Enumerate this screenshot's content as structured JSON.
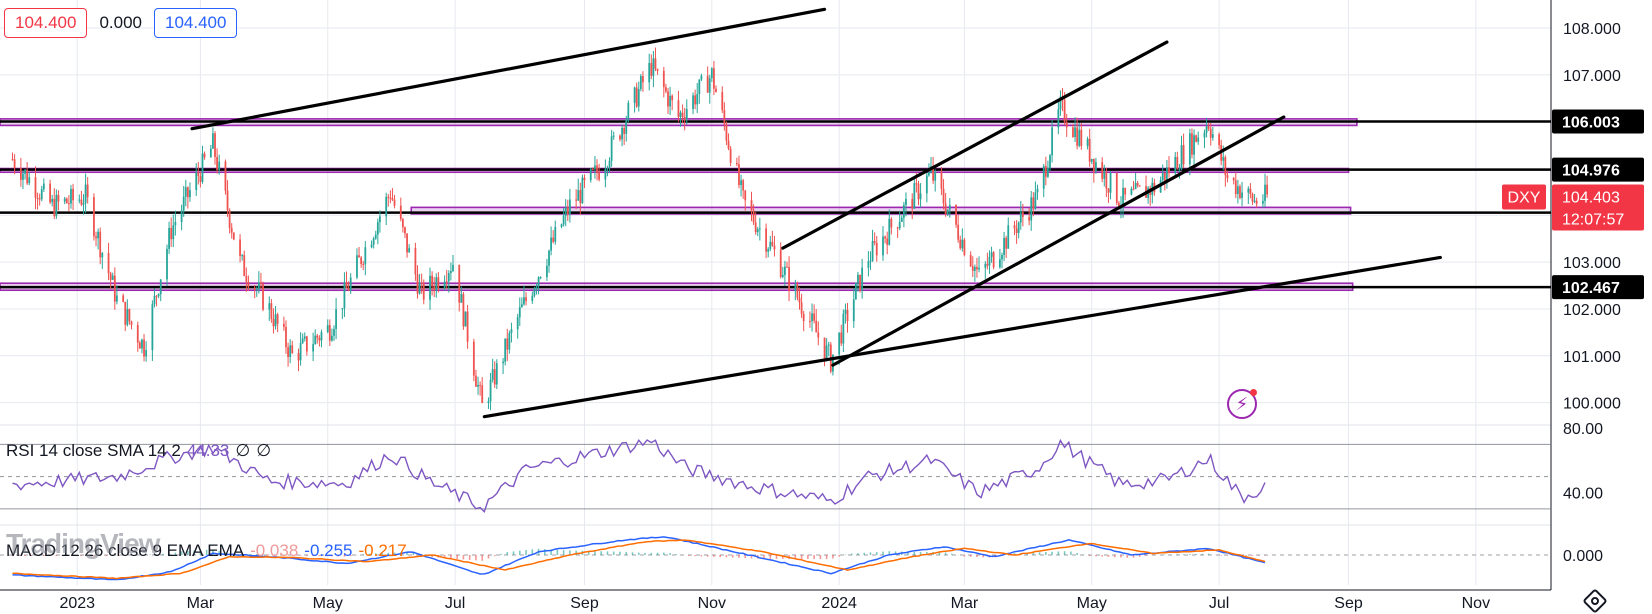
{
  "header": {
    "open_value": "104.400",
    "change_value": "0.000",
    "close_value": "104.400"
  },
  "symbol": {
    "ticker": "DXY",
    "price": "104.403",
    "countdown": "12:07:57"
  },
  "watermark": "TradingView",
  "colors": {
    "up": "#26a69a",
    "down": "#ef5350",
    "zone": "#9c27b0",
    "zone_fill": "rgba(156,39,176,0.22)",
    "trendline": "#000000",
    "rsi": "#7e57c2",
    "macd": "#2962ff",
    "signal": "#ff6d00",
    "price_tag": "#f23645"
  },
  "rsi": {
    "label": "RSI 14 close SMA 14 2",
    "value": "44.33",
    "v2": "∅",
    "v3": "∅"
  },
  "macd": {
    "label": "MACD 12 26 close 9 EMA EMA",
    "histogram": "-0.038",
    "macd": "-0.255",
    "signal": "-0.217"
  },
  "icons": {
    "alert": "lightning-bolt-icon",
    "settings": "settings-icon"
  },
  "chart_data": {
    "type": "candlestick",
    "symbol": "DXY",
    "x_tick_labels": [
      "2023",
      "Mar",
      "May",
      "Jul",
      "Sep",
      "Nov",
      "2024",
      "Mar",
      "May",
      "Jul",
      "Sep",
      "Nov"
    ],
    "x_tick_dates": [
      "2023-01-01",
      "2023-03-01",
      "2023-05-01",
      "2023-07-01",
      "2023-09-01",
      "2023-11-01",
      "2024-01-01",
      "2024-03-01",
      "2024-05-01",
      "2024-07-01",
      "2024-09-01",
      "2024-11-01"
    ],
    "x_range": [
      "2022-11-25",
      "2024-12-07"
    ],
    "y_tick_labels": [
      "100.000",
      "101.000",
      "102.000",
      "103.000",
      "104.000",
      "105.000",
      "106.000",
      "107.000",
      "108.000"
    ],
    "y_range": [
      99.65,
      108.3
    ],
    "grid": true,
    "price_path": [
      [
        "2022-12-01",
        105.2
      ],
      [
        "2022-12-20",
        104.2
      ],
      [
        "2023-01-05",
        104.4
      ],
      [
        "2023-01-20",
        102.2
      ],
      [
        "2023-02-02",
        101.2
      ],
      [
        "2023-02-15",
        103.7
      ],
      [
        "2023-03-07",
        105.5
      ],
      [
        "2023-03-20",
        103.0
      ],
      [
        "2023-04-03",
        102.0
      ],
      [
        "2023-04-14",
        101.0
      ],
      [
        "2023-05-02",
        101.6
      ],
      [
        "2023-05-31",
        104.5
      ],
      [
        "2023-06-15",
        102.3
      ],
      [
        "2023-06-30",
        103.0
      ],
      [
        "2023-07-14",
        99.9
      ],
      [
        "2023-08-01",
        101.9
      ],
      [
        "2023-08-25",
        104.2
      ],
      [
        "2023-09-10",
        105.1
      ],
      [
        "2023-10-03",
        107.2
      ],
      [
        "2023-10-16",
        106.1
      ],
      [
        "2023-11-01",
        107.0
      ],
      [
        "2023-11-16",
        104.3
      ],
      [
        "2023-12-01",
        103.2
      ],
      [
        "2023-12-28",
        100.9
      ],
      [
        "2024-01-15",
        103.1
      ],
      [
        "2024-02-14",
        104.9
      ],
      [
        "2024-03-08",
        102.7
      ],
      [
        "2024-04-05",
        104.4
      ],
      [
        "2024-04-16",
        106.3
      ],
      [
        "2024-05-15",
        104.3
      ],
      [
        "2024-05-31",
        104.6
      ],
      [
        "2024-06-26",
        106.0
      ],
      [
        "2024-07-05",
        104.8
      ],
      [
        "2024-07-18",
        104.3
      ],
      [
        "2024-07-24",
        104.4
      ]
    ],
    "horizontal_levels": [
      {
        "label": "106.003",
        "value": 106.003
      },
      {
        "label": "104.976",
        "value": 104.976
      },
      {
        "label": "104.059",
        "value": 104.059
      },
      {
        "label": "102.467",
        "value": 102.467
      }
    ],
    "zones": [
      {
        "from": "2022-11-25",
        "to": "2024-09-05",
        "low": 105.92,
        "high": 106.06
      },
      {
        "from": "2022-11-25",
        "to": "2024-09-01",
        "low": 104.92,
        "high": 105.0
      },
      {
        "from": "2023-06-10",
        "to": "2024-09-02",
        "low": 104.03,
        "high": 104.17
      },
      {
        "from": "2022-11-25",
        "to": "2024-09-03",
        "low": 102.4,
        "high": 102.55
      }
    ],
    "trendlines": [
      {
        "from": [
          "2023-02-25",
          105.85
        ],
        "to": [
          "2023-12-25",
          108.4
        ]
      },
      {
        "from": [
          "2023-07-15",
          99.7
        ],
        "to": [
          "2024-10-15",
          103.1
        ]
      },
      {
        "from": [
          "2023-12-05",
          103.3
        ],
        "to": [
          "2024-06-06",
          107.7
        ]
      },
      {
        "from": [
          "2023-12-29",
          100.8
        ],
        "to": [
          "2024-08-01",
          106.1
        ]
      }
    ],
    "rsi": {
      "y_tick_labels": [
        "40.00",
        "80.00"
      ],
      "y_range": [
        20,
        82
      ],
      "bands": [
        30,
        50,
        70
      ],
      "path": [
        [
          "2022-12-01",
          45
        ],
        [
          "2023-01-20",
          50
        ],
        [
          "2023-02-15",
          62
        ],
        [
          "2023-03-07",
          68
        ],
        [
          "2023-04-03",
          47
        ],
        [
          "2023-05-10",
          46
        ],
        [
          "2023-05-31",
          64
        ],
        [
          "2023-06-20",
          46
        ],
        [
          "2023-07-14",
          31
        ],
        [
          "2023-08-05",
          55
        ],
        [
          "2023-09-05",
          64
        ],
        [
          "2023-10-03",
          72
        ],
        [
          "2023-10-20",
          55
        ],
        [
          "2023-11-20",
          44
        ],
        [
          "2023-12-28",
          35
        ],
        [
          "2024-01-15",
          50
        ],
        [
          "2024-02-14",
          60
        ],
        [
          "2024-03-08",
          40
        ],
        [
          "2024-04-05",
          55
        ],
        [
          "2024-04-16",
          71
        ],
        [
          "2024-05-15",
          45
        ],
        [
          "2024-06-06",
          48
        ],
        [
          "2024-06-26",
          61
        ],
        [
          "2024-07-12",
          37
        ],
        [
          "2024-07-24",
          44.33
        ]
      ]
    },
    "macd": {
      "y_tick_labels": [
        "0.000"
      ],
      "y_range": [
        -0.9,
        0.9
      ],
      "zero": 0,
      "macd_path": [
        [
          "2022-12-01",
          -0.6
        ],
        [
          "2023-01-20",
          -0.75
        ],
        [
          "2023-02-15",
          -0.5
        ],
        [
          "2023-03-07",
          0.05
        ],
        [
          "2023-04-03",
          -0.05
        ],
        [
          "2023-05-10",
          -0.25
        ],
        [
          "2023-06-10",
          0.1
        ],
        [
          "2023-07-14",
          -0.6
        ],
        [
          "2023-08-10",
          0.1
        ],
        [
          "2023-09-20",
          0.45
        ],
        [
          "2023-10-10",
          0.55
        ],
        [
          "2023-11-15",
          0.05
        ],
        [
          "2023-12-28",
          -0.55
        ],
        [
          "2024-01-25",
          0.0
        ],
        [
          "2024-02-20",
          0.25
        ],
        [
          "2024-03-15",
          -0.05
        ],
        [
          "2024-04-20",
          0.45
        ],
        [
          "2024-05-20",
          0.0
        ],
        [
          "2024-06-26",
          0.2
        ],
        [
          "2024-07-24",
          -0.255
        ]
      ],
      "signal_path": [
        [
          "2022-12-01",
          -0.55
        ],
        [
          "2023-01-20",
          -0.7
        ],
        [
          "2023-02-20",
          -0.55
        ],
        [
          "2023-03-15",
          -0.05
        ],
        [
          "2023-04-15",
          -0.08
        ],
        [
          "2023-05-20",
          -0.2
        ],
        [
          "2023-06-20",
          0.0
        ],
        [
          "2023-07-25",
          -0.45
        ],
        [
          "2023-08-25",
          0.0
        ],
        [
          "2023-09-30",
          0.4
        ],
        [
          "2023-10-20",
          0.45
        ],
        [
          "2023-11-25",
          0.1
        ],
        [
          "2024-01-05",
          -0.45
        ],
        [
          "2024-02-05",
          -0.05
        ],
        [
          "2024-03-01",
          0.2
        ],
        [
          "2024-03-25",
          0.0
        ],
        [
          "2024-04-30",
          0.35
        ],
        [
          "2024-05-30",
          0.05
        ],
        [
          "2024-07-01",
          0.15
        ],
        [
          "2024-07-24",
          -0.217
        ]
      ]
    }
  }
}
